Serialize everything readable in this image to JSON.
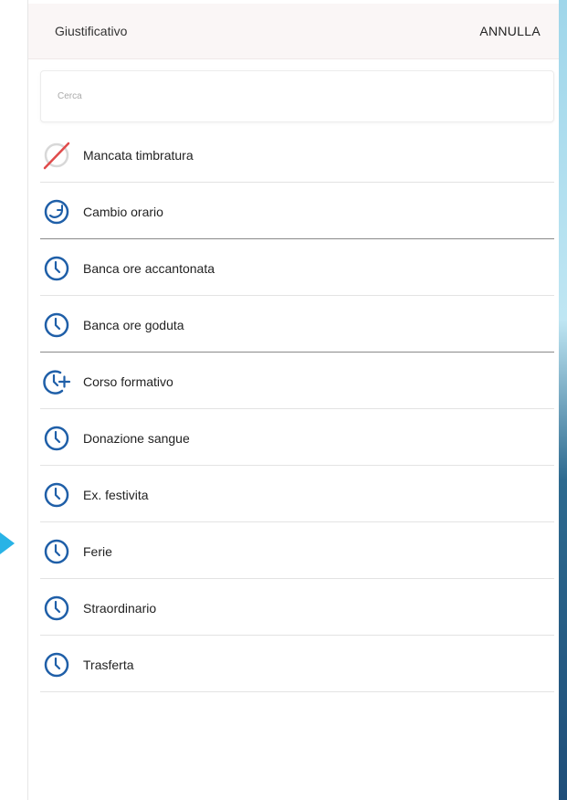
{
  "header": {
    "title": "Giustificativo",
    "cancel_label": "ANNULLA"
  },
  "search": {
    "placeholder": "Cerca",
    "value": ""
  },
  "items": [
    {
      "label": "Mancata timbratura",
      "icon": "no-punch-icon"
    },
    {
      "label": "Cambio orario",
      "icon": "clock-change-icon"
    },
    {
      "label": "Banca ore accantonata",
      "icon": "clock-icon"
    },
    {
      "label": "Banca ore goduta",
      "icon": "clock-icon"
    },
    {
      "label": "Corso formativo",
      "icon": "clock-plus-icon"
    },
    {
      "label": "Donazione sangue",
      "icon": "clock-icon"
    },
    {
      "label": "Ex. festivita",
      "icon": "clock-icon"
    },
    {
      "label": "Ferie",
      "icon": "clock-icon"
    },
    {
      "label": "Straordinario",
      "icon": "clock-icon"
    },
    {
      "label": "Trasferta",
      "icon": "clock-icon"
    }
  ],
  "colors": {
    "icon_blue": "#1f5fa8",
    "no_punch_red": "#e04b4b",
    "header_bg": "#faf6f6"
  }
}
